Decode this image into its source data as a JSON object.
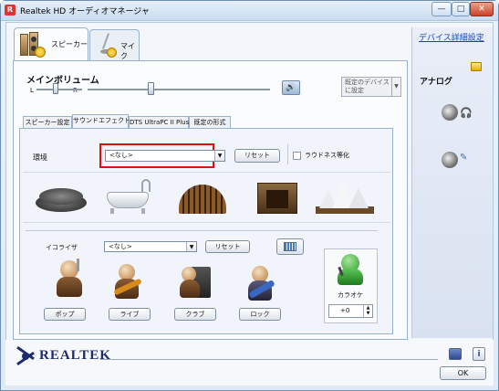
{
  "window": {
    "title": "Realtek HD オーディオマネージャ",
    "minimize": "—",
    "maximize": "□",
    "close": "✕"
  },
  "device_tabs": [
    "スピーカー",
    "マイク"
  ],
  "advanced_link": "デバイス詳細設定",
  "main_volume": {
    "label": "メインボリューム",
    "left": "L",
    "right": "R",
    "balance_level": 0.5,
    "volume_level": 0.48
  },
  "default_device": "既定のデバイス\nに設定",
  "sub_tabs": [
    "スピーカー設定",
    "サウンドエフェクト",
    "DTS UltraPC II Plus",
    "既定の形式"
  ],
  "environment": {
    "label": "環境",
    "value": "<なし>",
    "reset": "リセット",
    "loudness_label": "ラウドネス等化",
    "loudness_checked": false
  },
  "equalizer": {
    "label": "イコライザ",
    "value": "<なし>",
    "reset": "リセット",
    "presets": [
      "ポップ",
      "ライブ",
      "クラブ",
      "ロック"
    ]
  },
  "karaoke": {
    "label": "カラオケ",
    "value": "+0"
  },
  "right_panel": {
    "heading": "アナログ"
  },
  "footer": {
    "brand": "REALTEK",
    "ok": "OK"
  },
  "colors": {
    "highlight": "#e01010",
    "link": "#1a3fbf",
    "brand": "#1c2a6e"
  }
}
